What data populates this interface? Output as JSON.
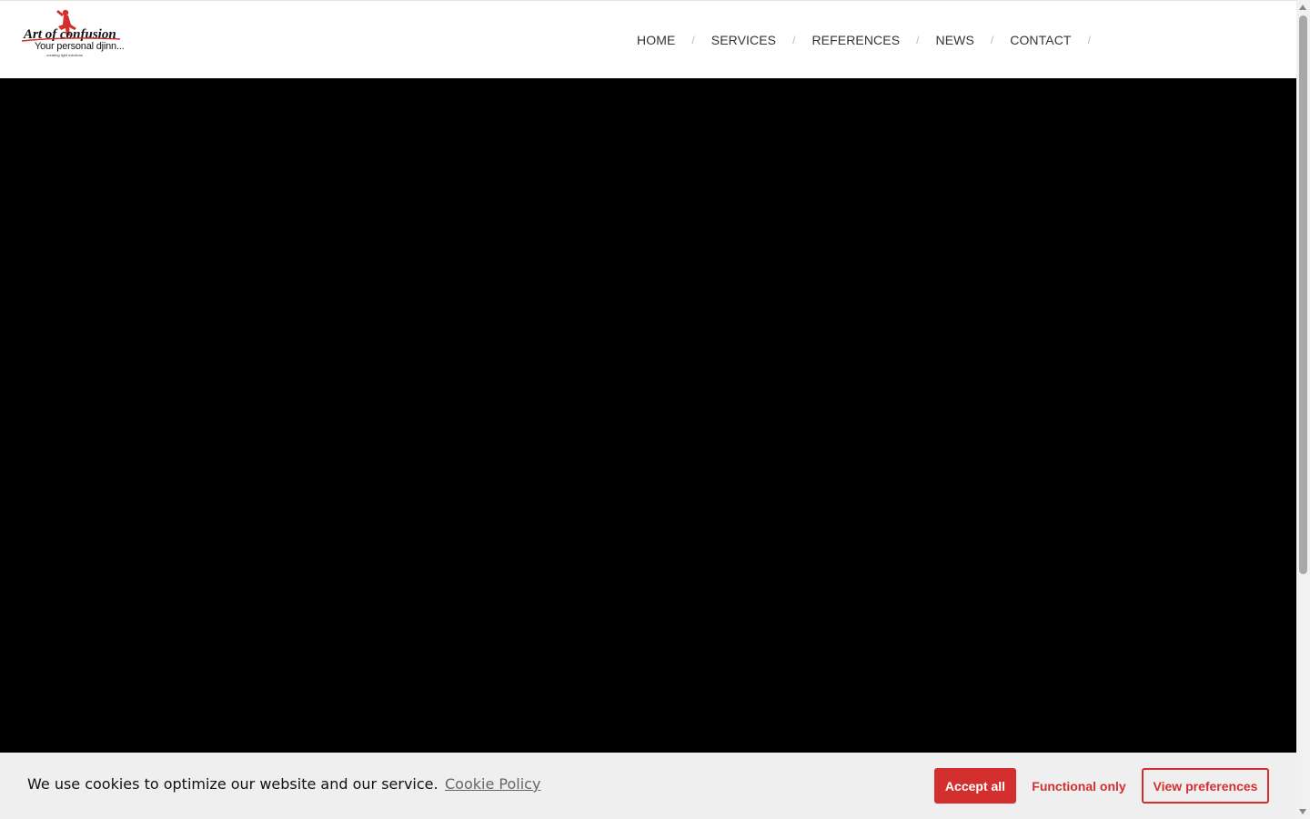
{
  "header": {
    "logo": {
      "brand_text": "Art of confusion",
      "tagline": "Your personal djinn...",
      "subline": "...creating light solutions",
      "accent_color": "#d32f2f"
    },
    "nav": {
      "items": [
        {
          "label": "HOME"
        },
        {
          "label": "SERVICES"
        },
        {
          "label": "REFERENCES"
        },
        {
          "label": "NEWS"
        },
        {
          "label": "CONTACT"
        }
      ],
      "separator": "/"
    }
  },
  "cookie_banner": {
    "message": "We use cookies to optimize our website and our service.",
    "policy_link": "Cookie Policy",
    "accept_all": "Accept all",
    "functional_only": "Functional only",
    "view_preferences": "View preferences",
    "accent_color": "#d32f2f"
  }
}
